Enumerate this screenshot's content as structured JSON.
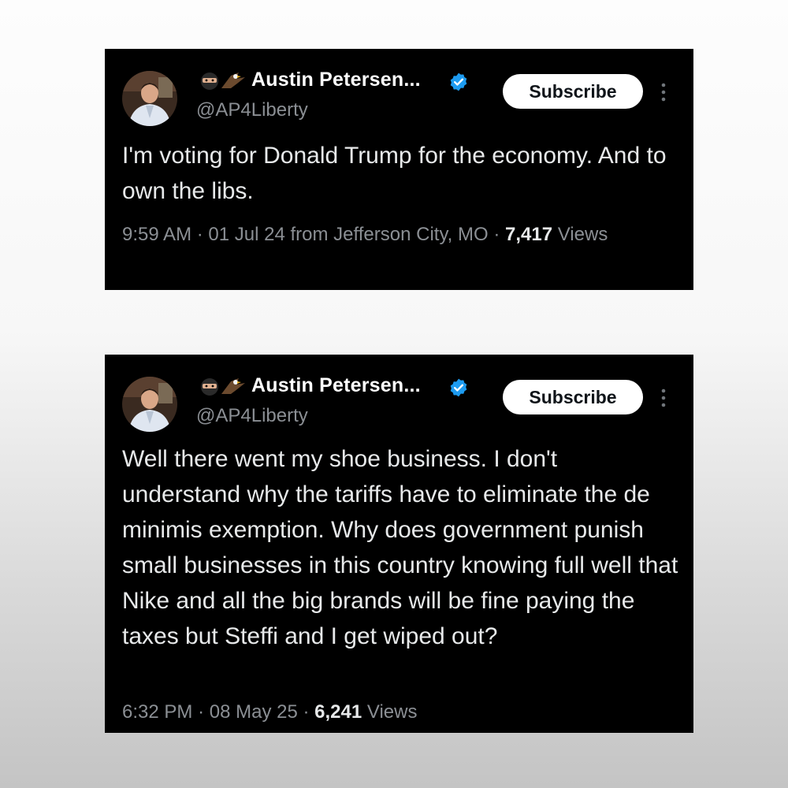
{
  "tweets": [
    {
      "author": {
        "name": "Austin Petersen...",
        "handle": "@AP4Liberty",
        "emoji_icons": [
          "ninja-icon",
          "eagle-icon"
        ],
        "verified": true
      },
      "subscribe_label": "Subscribe",
      "text": "I'm voting for Donald Trump for the economy. And to own the libs.",
      "time": "9:59 AM",
      "date": "01 Jul 24",
      "location": "from Jefferson City, MO",
      "views_count": "7,417",
      "views_label": "Views"
    },
    {
      "author": {
        "name": "Austin Petersen...",
        "handle": "@AP4Liberty",
        "emoji_icons": [
          "ninja-icon",
          "eagle-icon"
        ],
        "verified": true
      },
      "subscribe_label": "Subscribe",
      "text": "Well there went my shoe business. I don't understand why the tariffs have to eliminate the de minimis exemption. Why does government punish small businesses in this country knowing full well that Nike and all the big brands will be fine paying the taxes but Steffi and I get wiped out?",
      "time": "6:32 PM",
      "date": "08 May 25",
      "views_count": "6,241",
      "views_label": "Views"
    }
  ],
  "colors": {
    "card_bg": "#000000",
    "text": "#e7e9ea",
    "muted": "#8b8f94",
    "verified_blue": "#1d9bf0",
    "button_bg": "#ffffff"
  }
}
